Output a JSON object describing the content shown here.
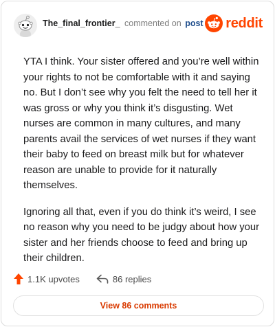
{
  "header": {
    "username": "The_final_frontier_",
    "action": "commented on",
    "post_link": "post",
    "brand": "reddit"
  },
  "comment": {
    "paragraphs": [
      "YTA I think. Your sister offered and you’re well within your rights to not be comfortable with it and saying no. But I don’t see why you felt the need to tell her it was gross or why you think it’s disgusting. Wet nurses are common in many cultures, and many parents avail the services of wet nurses if they want their baby to feed on breast milk but for whatever reason are unable to provide for it naturally themselves.",
      "Ignoring all that, even if you do think it’s weird, I see no reason why you need to be judgy about how your sister and her friends choose to feed and bring up their children."
    ]
  },
  "actions": {
    "upvotes": "1.1K upvotes",
    "replies": "86 replies"
  },
  "view_comments_label": "View 86 comments",
  "colors": {
    "brand": "#ff4500",
    "upvote": "#ff4500",
    "link": "#d93a00"
  },
  "icons": {
    "avatar": "snoo-avatar-icon",
    "brand": "reddit-logo-icon",
    "upvote": "upvote-arrow-icon",
    "reply": "reply-arrow-icon"
  }
}
